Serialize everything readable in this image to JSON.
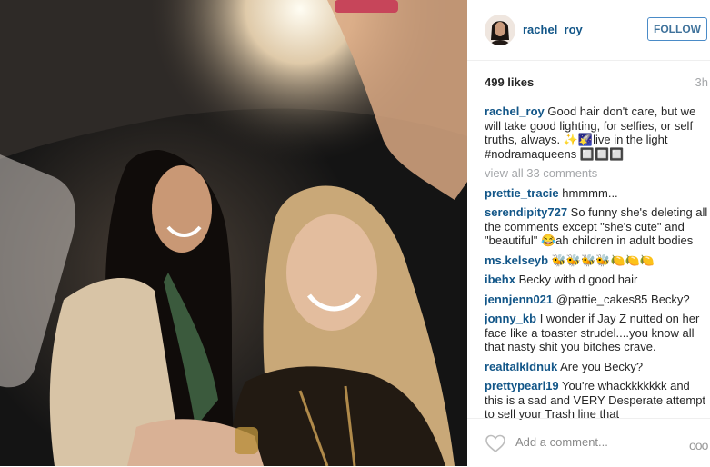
{
  "post": {
    "username": "rachel_roy",
    "follow_label": "FOLLOW",
    "likes": "499 likes",
    "time": "3h",
    "caption_user": "rachel_roy",
    "caption_text": "Good hair don't care, but we will take good lighting, for selfies, or self truths, always. ✨🌠live in the light #nodramaqueens 🔲🔲🔲",
    "view_all": "view all 33 comments",
    "add_comment_placeholder": "Add a comment...",
    "more_label": "ooo"
  },
  "comments": [
    {
      "user": "prettie_tracie",
      "text": "hmmmm..."
    },
    {
      "user": "serendipity727",
      "text": "So funny she's deleting all the comments except \"she's cute\" and \"beautiful\" 😂ah children in adult bodies"
    },
    {
      "user": "ms.kelseyb",
      "text": "🐝🐝🐝🐝🍋🍋🍋"
    },
    {
      "user": "ibehx",
      "text": "Becky with d good hair"
    },
    {
      "user": "jennjenn021",
      "text": "@pattie_cakes85 Becky?"
    },
    {
      "user": "jonny_kb",
      "text": "I wonder if Jay Z nutted on her face like a toaster strudel....you know all that nasty shit you bitches crave."
    },
    {
      "user": "realtalkldnuk",
      "text": "Are you Becky?"
    },
    {
      "user": "prettypearl19",
      "text": "You're whackkkkkkk and this is a sad and VERY Desperate attempt to sell your Trash line that"
    }
  ],
  "icons": {
    "avatar": "profile-avatar",
    "heart": "heart-icon",
    "more": "more-options-icon"
  },
  "colors": {
    "username_blue": "#125688",
    "follow_blue": "#3f729b",
    "muted": "#a5a7aa"
  }
}
